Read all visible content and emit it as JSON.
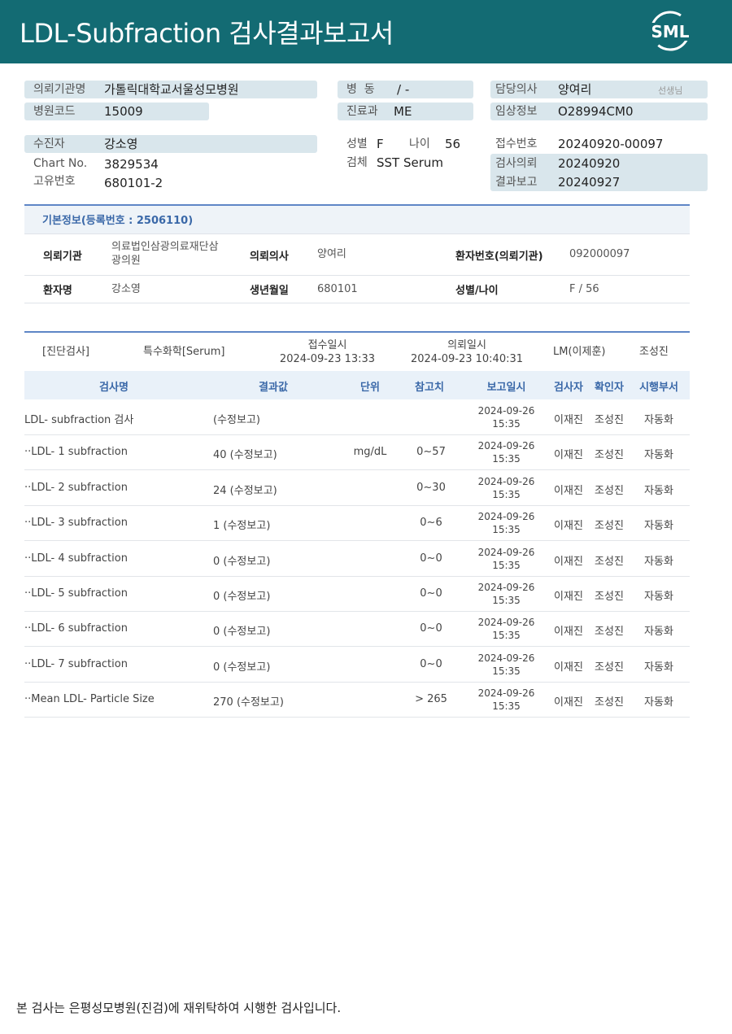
{
  "header": {
    "title": "LDL-Subfraction 검사결과보고서",
    "logo_text": "SML"
  },
  "patient_header": {
    "institution_label": "의뢰기관명",
    "institution_value": "가톨릭대학교서울성모병원",
    "hospital_code_label": "병원코드",
    "hospital_code_value": "15009",
    "ward_label": "병  동",
    "ward_value": "/ -",
    "dept_label": "진료과",
    "dept_value": "ME",
    "doctor_label": "담당의사",
    "doctor_value": "양여리",
    "doctor_suffix": "선생님",
    "clinical_label": "임상정보",
    "clinical_value": "O28994CM0",
    "patient_label": "수진자",
    "patient_value": "강소영",
    "chart_label": "Chart No.",
    "chart_value": "3829534",
    "unique_label": "고유번호",
    "unique_value": "680101-2",
    "sex_label": "성별",
    "sex_value": "F",
    "age_label": "나이",
    "age_value": "56",
    "specimen_label": "검체",
    "specimen_value": "SST Serum",
    "receipt_label": "접수번호",
    "receipt_value": "20240920-00097",
    "request_label": "검사의뢰",
    "request_value": "20240920",
    "report_label": "결과보고",
    "report_value": "20240927"
  },
  "basic_info": {
    "title": "기본정보(등록번호 : 2506110)",
    "institution_label": "의뢰기관",
    "institution_value_1": "의료법인삼광의료재단삼",
    "institution_value_2": "광의원",
    "doctor_label": "의뢰의사",
    "doctor_value": "양여리",
    "patient_no_label": "환자번호(의뢰기관)",
    "patient_no_value": "092000097",
    "name_label": "환자명",
    "name_value": "강소영",
    "dob_label": "생년월일",
    "dob_value": "680101",
    "sex_age_label": "성별/나이",
    "sex_age_value": "F / 56"
  },
  "test_meta": {
    "category": "[진단검사]",
    "subcategory": "특수화학[Serum]",
    "receipt_time_label": "접수일시",
    "receipt_time_value": "2024-09-23 13:33",
    "request_time_label": "의뢰일시",
    "request_time_value": "2024-09-23 10:40:31",
    "lm": "LM(이제훈)",
    "verifier": "조성진"
  },
  "results": {
    "headers": {
      "name": "검사명",
      "value": "결과값",
      "unit": "단위",
      "ref": "참고치",
      "date": "보고일시",
      "tester": "검사자",
      "checker": "확인자",
      "dept": "시행부서"
    },
    "rows": [
      {
        "name": "LDL- subfraction 검사",
        "value": "(수정보고)",
        "unit": "",
        "ref": "",
        "date1": "2024-09-26",
        "date2": "15:35",
        "tester": "이재진",
        "checker": "조성진",
        "dept": "자동화"
      },
      {
        "name": "··LDL- 1 subfraction",
        "value": "40 (수정보고)",
        "unit": "mg/dL",
        "ref": "0~57",
        "date1": "2024-09-26",
        "date2": "15:35",
        "tester": "이재진",
        "checker": "조성진",
        "dept": "자동화"
      },
      {
        "name": "··LDL- 2 subfraction",
        "value": "24 (수정보고)",
        "unit": "",
        "ref": "0~30",
        "date1": "2024-09-26",
        "date2": "15:35",
        "tester": "이재진",
        "checker": "조성진",
        "dept": "자동화"
      },
      {
        "name": "··LDL- 3 subfraction",
        "value": "1 (수정보고)",
        "unit": "",
        "ref": "0~6",
        "date1": "2024-09-26",
        "date2": "15:35",
        "tester": "이재진",
        "checker": "조성진",
        "dept": "자동화"
      },
      {
        "name": "··LDL- 4 subfraction",
        "value": "0 (수정보고)",
        "unit": "",
        "ref": "0~0",
        "date1": "2024-09-26",
        "date2": "15:35",
        "tester": "이재진",
        "checker": "조성진",
        "dept": "자동화"
      },
      {
        "name": "··LDL- 5 subfraction",
        "value": "0 (수정보고)",
        "unit": "",
        "ref": "0~0",
        "date1": "2024-09-26",
        "date2": "15:35",
        "tester": "이재진",
        "checker": "조성진",
        "dept": "자동화"
      },
      {
        "name": "··LDL- 6 subfraction",
        "value": "0 (수정보고)",
        "unit": "",
        "ref": "0~0",
        "date1": "2024-09-26",
        "date2": "15:35",
        "tester": "이재진",
        "checker": "조성진",
        "dept": "자동화"
      },
      {
        "name": "··LDL- 7 subfraction",
        "value": "0 (수정보고)",
        "unit": "",
        "ref": "0~0",
        "date1": "2024-09-26",
        "date2": "15:35",
        "tester": "이재진",
        "checker": "조성진",
        "dept": "자동화"
      },
      {
        "name": "··Mean LDL- Particle Size",
        "value": "270 (수정보고)",
        "unit": "",
        "ref": "> 265",
        "date1": "2024-09-26",
        "date2": "15:35",
        "tester": "이재진",
        "checker": "조성진",
        "dept": "자동화"
      }
    ]
  },
  "footer": {
    "note": "본 검사는 은평성모병원(진검)에 재위탁하여 시행한 검사입니다."
  },
  "colors": {
    "header_bg": "#136b73",
    "label_box": "#d9e6ec",
    "section_accent": "#3a68a8"
  },
  "icons": [
    "sml-logo"
  ]
}
